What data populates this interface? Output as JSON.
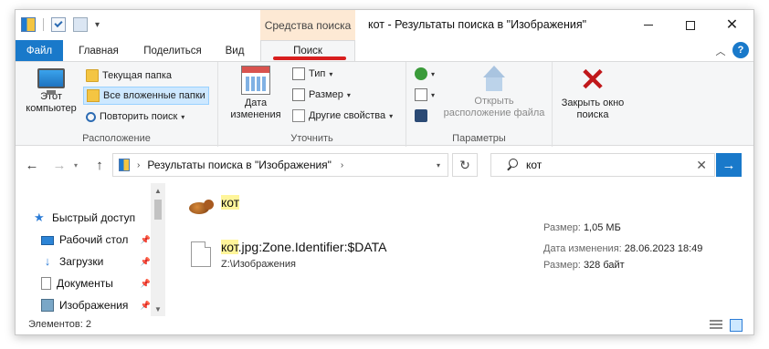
{
  "titlebar": {
    "contextual_group": "Средства поиска",
    "title": "кот - Результаты поиска в \"Изображения\""
  },
  "tabs": {
    "file": "Файл",
    "home": "Главная",
    "share": "Поделиться",
    "view": "Вид",
    "search": "Поиск"
  },
  "ribbon": {
    "location": {
      "this_pc": "Этот компьютер",
      "current_folder": "Текущая папка",
      "all_subfolders": "Все вложенные папки",
      "search_again": "Повторить поиск",
      "label": "Расположение"
    },
    "refine": {
      "date_modified": "Дата изменения",
      "type": "Тип",
      "size": "Размер",
      "other_properties": "Другие свойства",
      "label": "Уточнить"
    },
    "options": {
      "open_location": "Открыть расположение файла",
      "label": "Параметры"
    },
    "close": {
      "close_search": "Закрыть окно поиска"
    }
  },
  "address": {
    "path": "Результаты поиска в \"Изображения\""
  },
  "search": {
    "value": "кот"
  },
  "navpane": {
    "items": [
      {
        "label": "Быстрый доступ",
        "icon": "star-icon"
      },
      {
        "label": "Рабочий стол",
        "icon": "desktop-icon"
      },
      {
        "label": "Загрузки",
        "icon": "downloads-icon"
      },
      {
        "label": "Документы",
        "icon": "documents-icon"
      },
      {
        "label": "Изображения",
        "icon": "pictures-icon"
      }
    ]
  },
  "results": [
    {
      "highlight": "кот",
      "rest": "",
      "size_label": "Размер:",
      "size": "1,05 МБ"
    },
    {
      "highlight": "кот",
      "rest": ".jpg:Zone.Identifier:$DATA",
      "path": "Z:\\Изображения",
      "date_label": "Дата изменения:",
      "date": "28.06.2023 18:49",
      "size_label": "Размер:",
      "size": "328 байт"
    }
  ],
  "status": {
    "items_count": "Элементов: 2"
  },
  "colors": {
    "accent": "#1979ca",
    "contextual_tab": "#fde9d4",
    "highlight": "#fff59a",
    "annotation_red": "#d81e1e",
    "close_x": "#c0181b"
  }
}
